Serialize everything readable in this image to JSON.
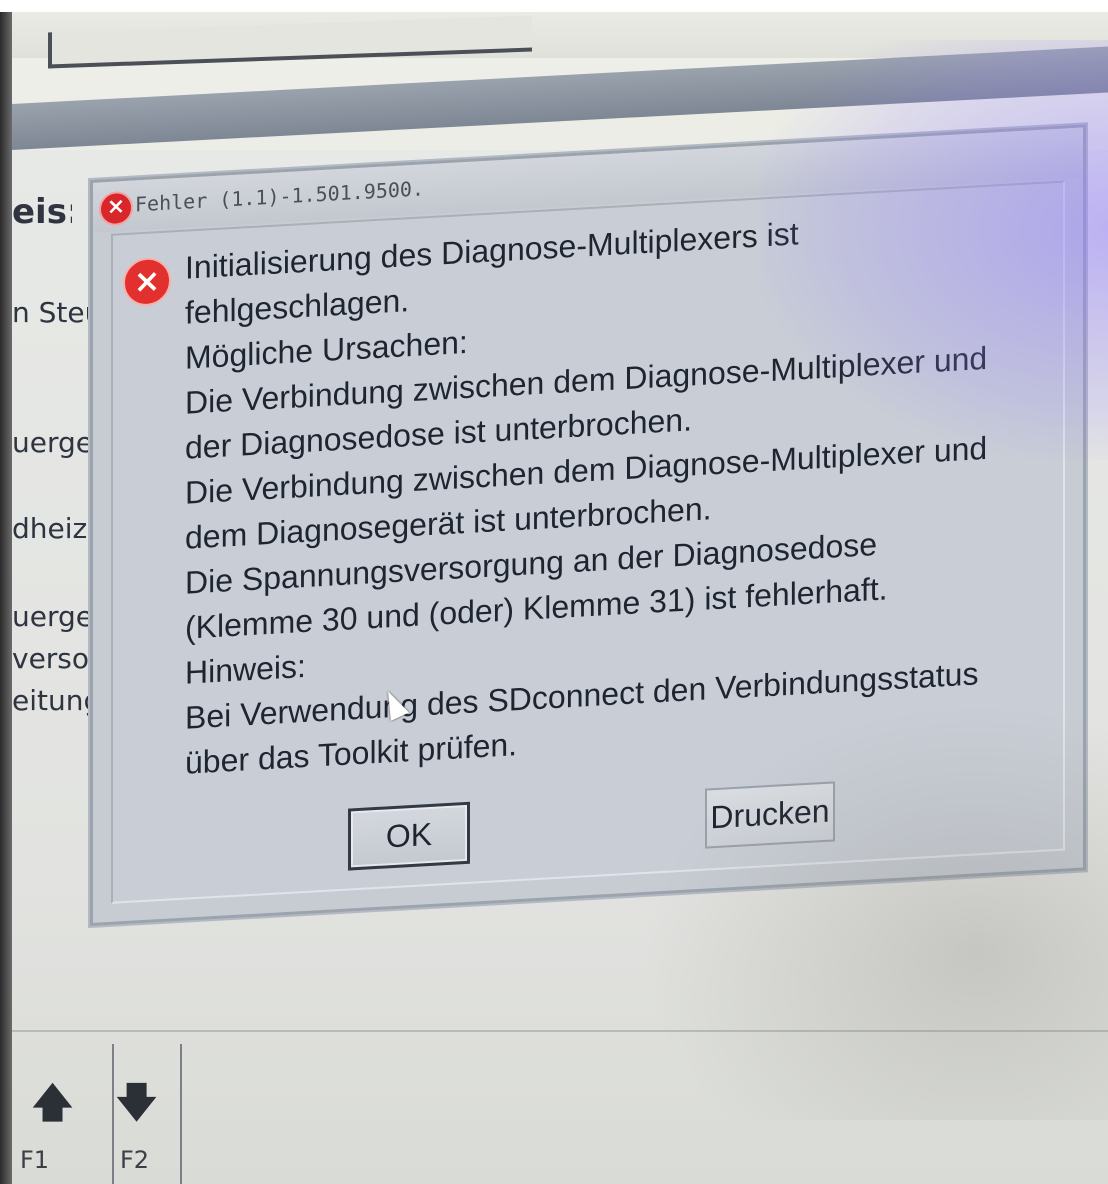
{
  "background_app": {
    "heading": "eis:",
    "items": [
      "n Steu",
      "uergeı",
      "dheizu",
      "uergerä",
      "versorç",
      "eitung c"
    ],
    "window_controls": [
      "_",
      "□",
      "X"
    ],
    "function_keys": [
      {
        "icon": "arrow-up-icon",
        "label": "F1"
      },
      {
        "icon": "arrow-down-icon",
        "label": "F2"
      }
    ]
  },
  "dialog": {
    "title": "Fehler (1.1)-1.501.9500.",
    "message_lines": [
      "Initialisierung des Diagnose-Multiplexers ist",
      "fehlgeschlagen.",
      "Mögliche Ursachen:",
      "Die Verbindung zwischen dem Diagnose-Multiplexer und",
      "der Diagnosedose ist unterbrochen.",
      "Die Verbindung zwischen dem Diagnose-Multiplexer und",
      "dem Diagnosegerät ist unterbrochen.",
      "Die Spannungsversorgung an der Diagnosedose",
      "(Klemme 30 und (oder) Klemme 31) ist fehlerhaft.",
      "Hinweis:",
      "Bei Verwendung des SDconnect den Verbindungsstatus",
      "über das Toolkit prüfen."
    ],
    "ok_label": "OK",
    "print_label": "Drucken",
    "error_icon": "error-icon",
    "accent_color": "#d8262a"
  }
}
